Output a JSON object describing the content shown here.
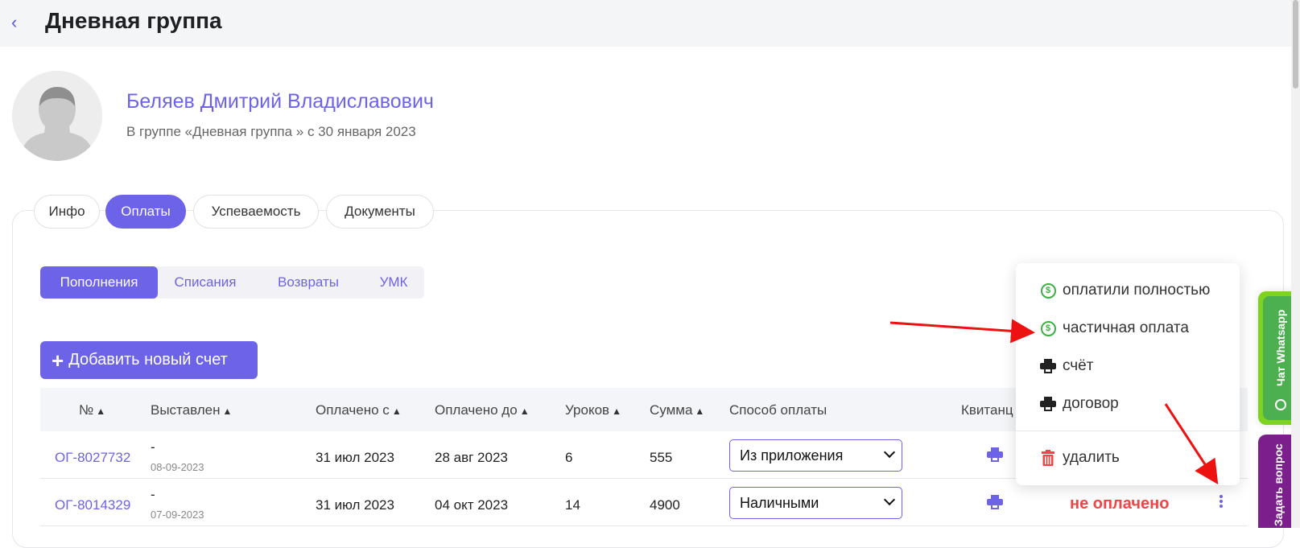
{
  "header": {
    "title": "Дневная группа",
    "back_icon": "chevron-left-icon"
  },
  "profile": {
    "name": "Беляев Дмитрий Владиславович",
    "subtitle": "В группе «Дневная группа » с 30 января 2023"
  },
  "tabs": [
    {
      "label": "Инфо",
      "active": false
    },
    {
      "label": "Оплаты",
      "active": true
    },
    {
      "label": "Успеваемость",
      "active": false
    },
    {
      "label": "Документы",
      "active": false
    }
  ],
  "subtabs": [
    {
      "label": "Пополнения",
      "active": true
    },
    {
      "label": "Списания",
      "active": false
    },
    {
      "label": "Возвраты",
      "active": false
    },
    {
      "label": "УМК",
      "active": false
    }
  ],
  "add_button": {
    "label": "Добавить новый счет"
  },
  "table": {
    "columns": [
      "№",
      "Выставлен",
      "Оплачено с",
      "Оплачено до",
      "Уроков",
      "Сумма",
      "Способ оплаты",
      "Квитанц"
    ],
    "rows": [
      {
        "number": "ОГ-8027732",
        "issued": "-",
        "issued_date": "08-09-2023",
        "paid_from": "31 июл 2023",
        "paid_to": "28 авг 2023",
        "lessons": "6",
        "sum": "555",
        "method": "Из приложения",
        "status": ""
      },
      {
        "number": "ОГ-8014329",
        "issued": "-",
        "issued_date": "07-09-2023",
        "paid_from": "31 июл 2023",
        "paid_to": "04 окт 2023",
        "lessons": "14",
        "sum": "4900",
        "method": "Наличными",
        "status": "не оплачено"
      }
    ]
  },
  "context_menu": {
    "items": [
      {
        "label": "оплатили полностью",
        "icon": "dollar-circle-icon"
      },
      {
        "label": "частичная оплата",
        "icon": "dollar-circle-icon"
      },
      {
        "label": "счёт",
        "icon": "printer-icon"
      },
      {
        "label": "договор",
        "icon": "printer-icon"
      },
      {
        "label": "удалить",
        "icon": "trash-icon"
      }
    ]
  },
  "side_widgets": {
    "whatsapp": "Чат Whatsapp",
    "question": "Задать вопрос"
  },
  "colors": {
    "accent": "#6c63e8",
    "danger": "#f04545",
    "whatsapp": "#4caf50",
    "question": "#7a1f8c"
  }
}
